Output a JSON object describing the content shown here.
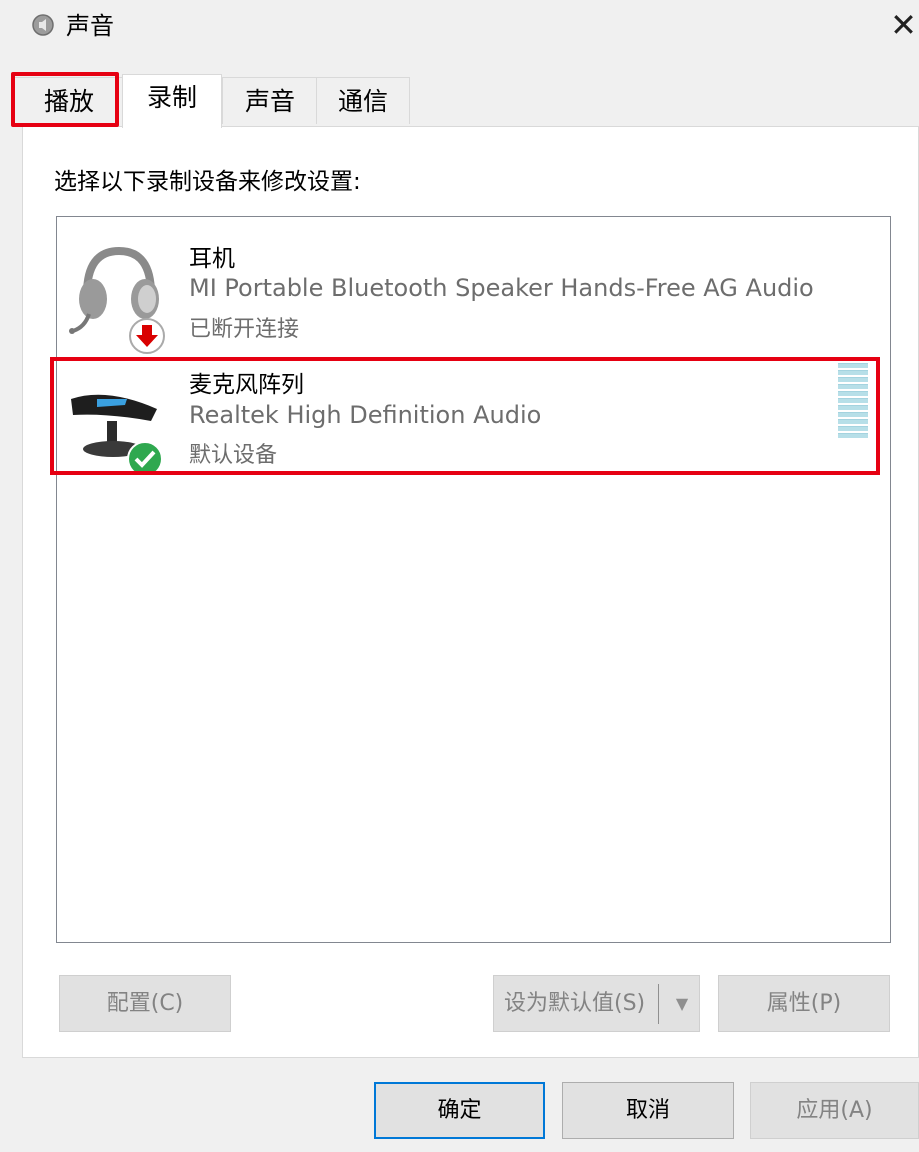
{
  "window": {
    "title": "声音",
    "close_glyph": "✕",
    "icon": "speaker-icon"
  },
  "tabs": [
    {
      "label": "播放",
      "selected": false
    },
    {
      "label": "录制",
      "selected": true
    },
    {
      "label": "声音",
      "selected": false
    },
    {
      "label": "通信",
      "selected": false
    }
  ],
  "instruction": "选择以下录制设备来修改设置:",
  "devices": [
    {
      "name": "耳机",
      "description": "MI Portable Bluetooth Speaker Hands-Free AG Audio",
      "status": "已断开连接",
      "icon": "headset-icon",
      "badge": "disconnected-arrow-icon"
    },
    {
      "name": "麦克风阵列",
      "description": "Realtek High Definition Audio",
      "status": "默认设备",
      "icon": "microphone-array-icon",
      "badge": "default-check-icon"
    }
  ],
  "buttons": {
    "configure": "配置(C)",
    "set_default": "设为默认值(S)",
    "properties": "属性(P)",
    "ok": "确定",
    "cancel": "取消",
    "apply": "应用(A)"
  },
  "colors": {
    "highlight": "#e60012",
    "focus": "#0078d7",
    "disabled_text": "#838383"
  }
}
